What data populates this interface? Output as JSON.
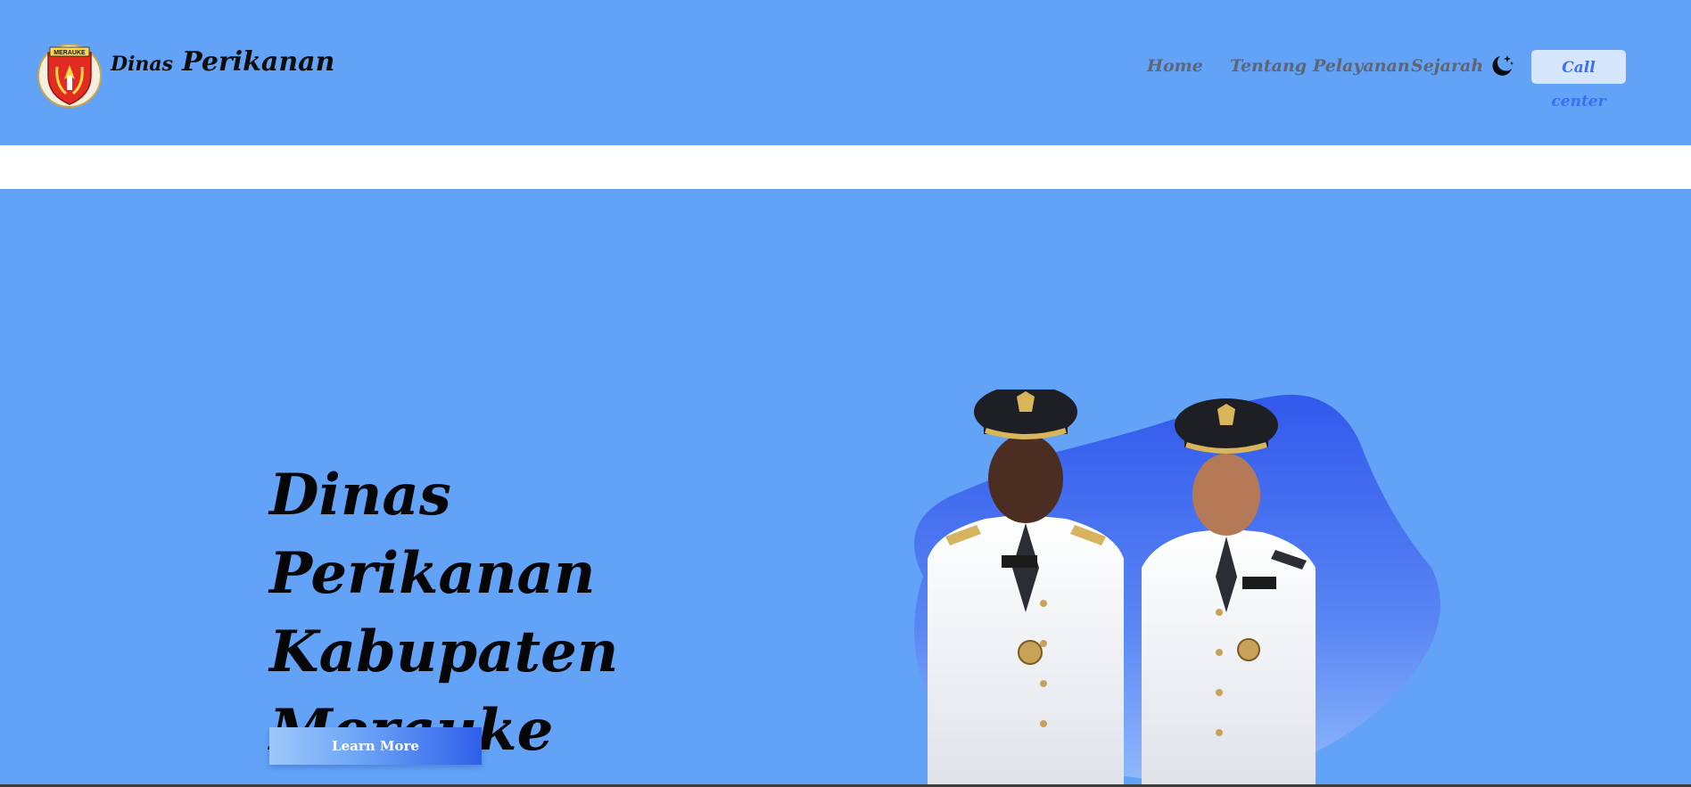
{
  "header": {
    "brand_small": "Dinas",
    "brand_big": "Perikanan",
    "logo_text": "MERAUKE",
    "nav": [
      {
        "label": "Home"
      },
      {
        "label": "Tentang"
      },
      {
        "label": "Pelayanan"
      },
      {
        "label": "Sejarah"
      }
    ],
    "theme_icon": "moon-stars-icon",
    "call_center": "Call center"
  },
  "hero": {
    "title_line1": "Dinas Perikanan",
    "title_line2": "Kabupaten",
    "title_line3": "Merauke",
    "cta": "Learn More",
    "image": "two-officials-portrait"
  },
  "colors": {
    "background": "#62a3f8",
    "band": "#ffffff",
    "nav_text": "#5f6572",
    "cta_start": "#9ec8fb",
    "cta_end": "#2f5fea",
    "blob": "#3a63ee"
  }
}
